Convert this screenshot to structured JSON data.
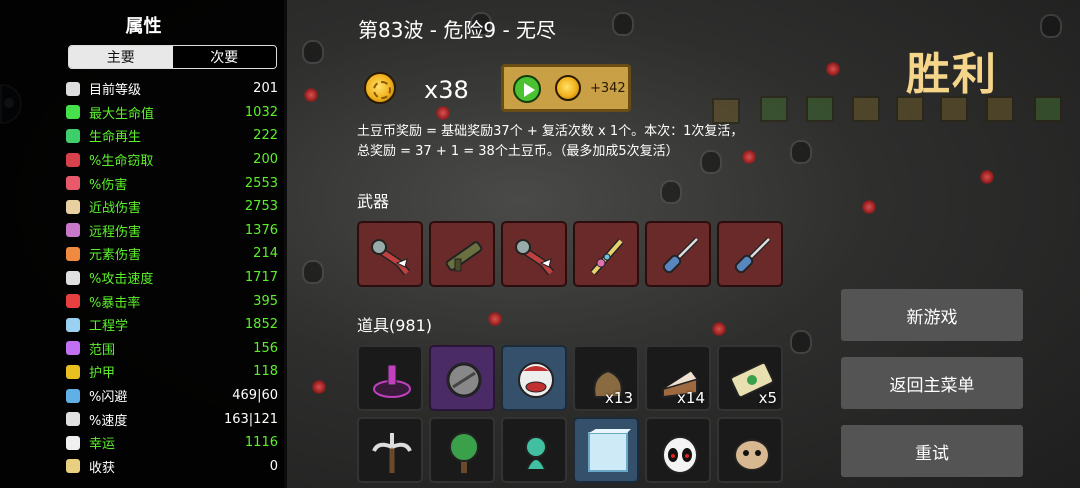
{
  "stats_panel": {
    "title": "属性",
    "tabs": [
      "主要",
      "次要"
    ],
    "active_tab": "主要",
    "stats": [
      {
        "icon": "level-icon",
        "name": "目前等级",
        "value": "201",
        "color": "white",
        "icon_color": "#dddddd"
      },
      {
        "icon": "heart-icon",
        "name": "最大生命值",
        "value": "1032",
        "color": "green",
        "icon_color": "#45e04a"
      },
      {
        "icon": "regen-icon",
        "name": "生命再生",
        "value": "222",
        "color": "green",
        "icon_color": "#3fcf6a"
      },
      {
        "icon": "lifesteal-icon",
        "name": "%生命窃取",
        "value": "200",
        "color": "green",
        "icon_color": "#d8404a"
      },
      {
        "icon": "damage-icon",
        "name": "%伤害",
        "value": "2553",
        "color": "green",
        "icon_color": "#e85a6a"
      },
      {
        "icon": "melee-icon",
        "name": "近战伤害",
        "value": "2753",
        "color": "green",
        "icon_color": "#e8d0a0"
      },
      {
        "icon": "ranged-icon",
        "name": "远程伤害",
        "value": "1376",
        "color": "green",
        "icon_color": "#c878c8"
      },
      {
        "icon": "elemental-icon",
        "name": "元素伤害",
        "value": "214",
        "color": "green",
        "icon_color": "#f08a40"
      },
      {
        "icon": "attack-speed-icon",
        "name": "%攻击速度",
        "value": "1717",
        "color": "green",
        "icon_color": "#e0e0e0"
      },
      {
        "icon": "crit-icon",
        "name": "%暴击率",
        "value": "395",
        "color": "green",
        "icon_color": "#e84040"
      },
      {
        "icon": "engineering-icon",
        "name": "工程学",
        "value": "1852",
        "color": "green",
        "icon_color": "#9ad0f0"
      },
      {
        "icon": "range-icon",
        "name": "范围",
        "value": "156",
        "color": "green",
        "icon_color": "#c070f0"
      },
      {
        "icon": "armor-icon",
        "name": "护甲",
        "value": "118",
        "color": "green",
        "icon_color": "#e8c020"
      },
      {
        "icon": "dodge-icon",
        "name": "%闪避",
        "value": "469|60",
        "color": "white",
        "icon_color": "#60b0e8"
      },
      {
        "icon": "speed-icon",
        "name": "%速度",
        "value": "163|121",
        "color": "white",
        "icon_color": "#e0e0e0"
      },
      {
        "icon": "luck-icon",
        "name": "幸运",
        "value": "1116",
        "color": "green",
        "icon_color": "#f0f0f0"
      },
      {
        "icon": "harvest-icon",
        "name": "收获",
        "value": "0",
        "color": "white",
        "icon_color": "#e8d080"
      }
    ]
  },
  "run": {
    "wave_title": "第83波 - 危险9 - 无尽",
    "result": "胜利",
    "coin_count": "x38",
    "bonus_amount": "+342",
    "reward_line1": "土豆币奖励 = 基础奖励37个 + 复活次数 x 1个。本次：1次复活，",
    "reward_line2": "总奖励 = 37 + 1 = 38个土豆币。（最多加成5次复活）"
  },
  "weapons": {
    "label": "武器",
    "slots": [
      {
        "icon": "dragon-rocket-launcher-icon"
      },
      {
        "icon": "rocket-launcher-icon"
      },
      {
        "icon": "dragon-rocket-launcher-icon"
      },
      {
        "icon": "jeweled-sword-icon"
      },
      {
        "icon": "screwdriver-icon"
      },
      {
        "icon": "screwdriver-icon"
      }
    ]
  },
  "items": {
    "label": "道具(981)",
    "row1": [
      {
        "icon": "ritual-altar-icon",
        "count": "",
        "tier": "dark"
      },
      {
        "icon": "spiked-ball-icon",
        "count": "",
        "tier": "purple"
      },
      {
        "icon": "clown-face-icon",
        "count": "",
        "tier": "blue"
      },
      {
        "icon": "potato-sack-icon",
        "count": "x13",
        "tier": "dark"
      },
      {
        "icon": "cake-slice-icon",
        "count": "x14",
        "tier": "dark"
      },
      {
        "icon": "banknote-icon",
        "count": "x5",
        "tier": "dark"
      }
    ],
    "row2": [
      {
        "icon": "palm-tree-icon",
        "count": "",
        "tier": "dark"
      },
      {
        "icon": "green-tree-icon",
        "count": "",
        "tier": "dark"
      },
      {
        "icon": "green-alien-icon",
        "count": "",
        "tier": "dark"
      },
      {
        "icon": "ice-cube-icon",
        "count": "",
        "tier": "blue"
      },
      {
        "icon": "ghost-mask-icon",
        "count": "",
        "tier": "dark"
      },
      {
        "icon": "stitched-potato-icon",
        "count": "",
        "tier": "dark"
      }
    ]
  },
  "menu": {
    "new_game": "新游戏",
    "main_menu": "返回主菜单",
    "retry": "重试"
  }
}
